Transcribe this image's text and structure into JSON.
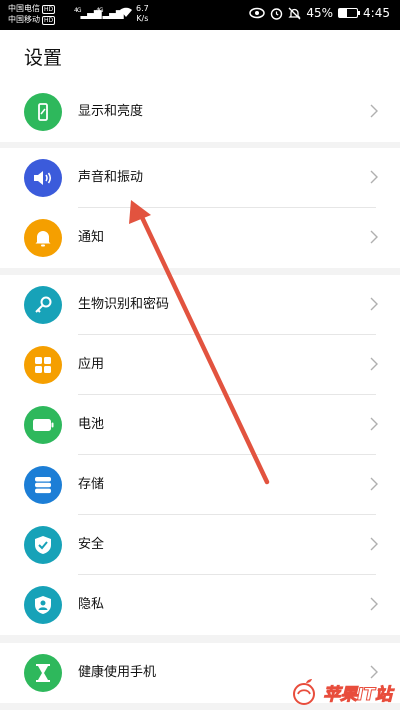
{
  "status_bar": {
    "carrier_1": "中国电信",
    "carrier_2": "中国移动",
    "hd_badge": "HD",
    "signal_1_type": "4G",
    "signal_2_type": "4G",
    "net_speed_value": "6.7",
    "net_speed_unit": "K/s",
    "battery_percent": "45%",
    "battery_level": 0.45,
    "time": "4:45",
    "icons": [
      "eye-icon",
      "alarm-icon",
      "mute-icon",
      "battery-icon"
    ]
  },
  "header": {
    "title": "设置"
  },
  "groups": [
    {
      "items": [
        {
          "label": "显示和亮度",
          "icon": "display-icon",
          "color": "#2eb85c"
        }
      ]
    },
    {
      "items": [
        {
          "label": "声音和振动",
          "icon": "volume-icon",
          "color": "#3b5bdb"
        },
        {
          "label": "通知",
          "icon": "bell-icon",
          "color": "#f59f00"
        }
      ]
    },
    {
      "items": [
        {
          "label": "生物识别和密码",
          "icon": "key-icon",
          "color": "#17a2b8"
        },
        {
          "label": "应用",
          "icon": "apps-icon",
          "color": "#f59f00"
        },
        {
          "label": "电池",
          "icon": "battery-icon",
          "color": "#2eb85c"
        },
        {
          "label": "存储",
          "icon": "storage-icon",
          "color": "#1c7ed6"
        },
        {
          "label": "安全",
          "icon": "shield-check-icon",
          "color": "#17a2b8"
        },
        {
          "label": "隐私",
          "icon": "privacy-icon",
          "color": "#17a2b8"
        }
      ]
    },
    {
      "items": [
        {
          "label": "健康使用手机",
          "icon": "hourglass-icon",
          "color": "#2eb85c"
        }
      ]
    }
  ],
  "annotation": {
    "arrow_color": "#e2533f"
  },
  "watermark": {
    "text": "苹果IT站",
    "color": "#e84d3c"
  }
}
